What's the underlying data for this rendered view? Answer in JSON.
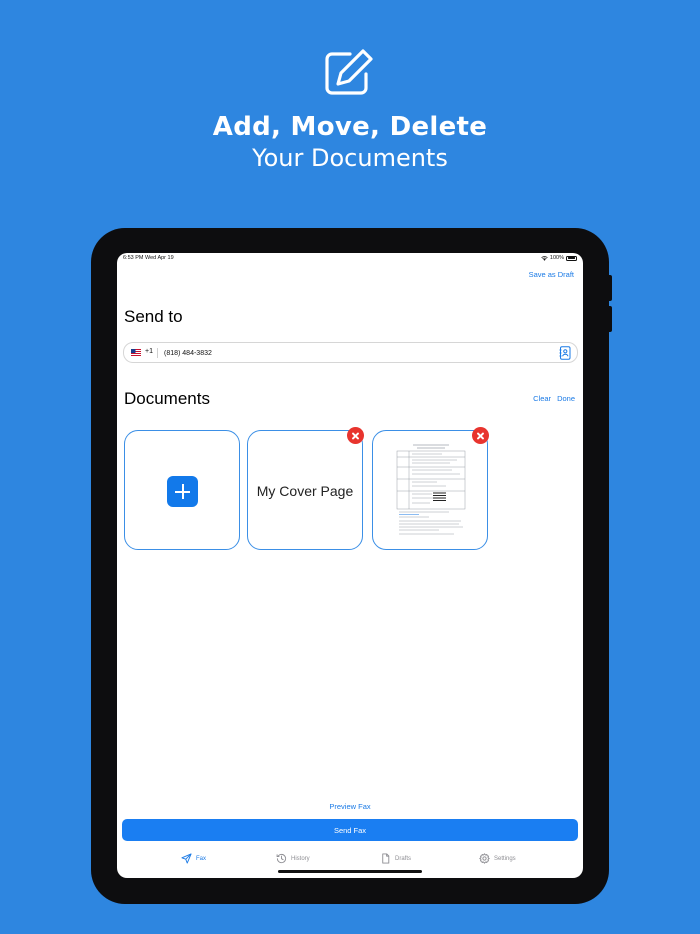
{
  "hero": {
    "title": "Add, Move, Delete",
    "subtitle": "Your Documents",
    "icon": "edit-icon"
  },
  "status_bar": {
    "time_date": "6:53 PM   Wed Apr 19",
    "battery": "100%"
  },
  "header": {
    "save_draft_label": "Save as Draft"
  },
  "send_to": {
    "title": "Send to",
    "country_code": "+1",
    "phone_value": "(818) 484-3832"
  },
  "documents": {
    "title": "Documents",
    "clear_label": "Clear",
    "done_label": "Done",
    "cover_page_label": "My Cover Page"
  },
  "footer": {
    "preview_label": "Preview Fax",
    "send_label": "Send Fax"
  },
  "tabs": [
    {
      "label": "Fax",
      "icon": "paper-plane-icon",
      "active": true
    },
    {
      "label": "History",
      "icon": "history-clock-icon",
      "active": false
    },
    {
      "label": "Drafts",
      "icon": "document-icon",
      "active": false
    },
    {
      "label": "Settings",
      "icon": "gear-icon",
      "active": false
    }
  ],
  "colors": {
    "background": "#2e86e0",
    "accent": "#1a7ae6",
    "delete": "#e8342e"
  }
}
